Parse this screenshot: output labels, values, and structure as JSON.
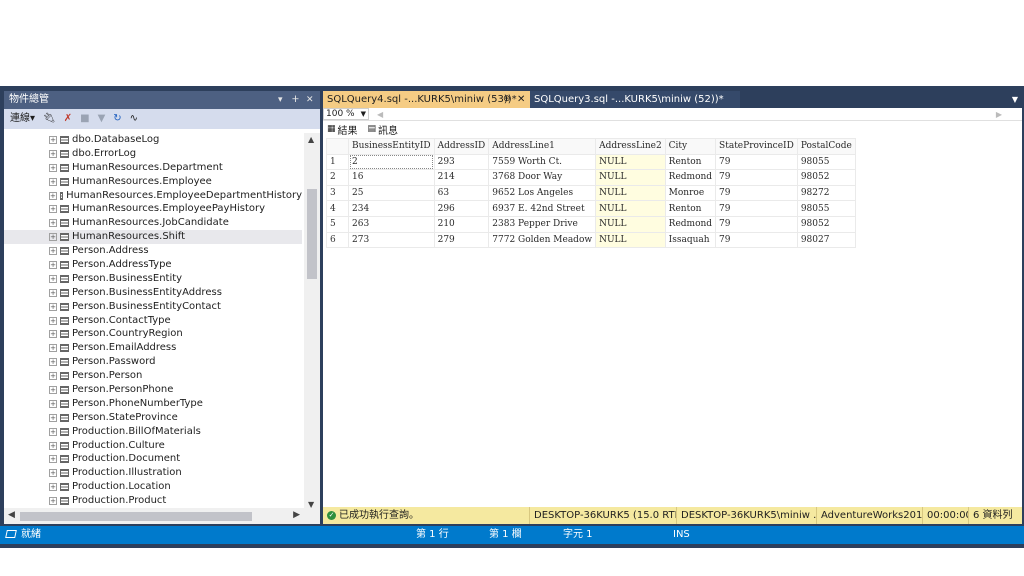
{
  "object_explorer": {
    "title": "物件總管",
    "controls": {
      "dropdown": "▾",
      "pin": "ⵜ",
      "close": "✕"
    },
    "toolbar": {
      "connect_label": "連線",
      "connect_caret": "▾"
    },
    "tree_items": [
      "dbo.DatabaseLog",
      "dbo.ErrorLog",
      "HumanResources.Department",
      "HumanResources.Employee",
      "HumanResources.EmployeeDepartmentHistory",
      "HumanResources.EmployeePayHistory",
      "HumanResources.JobCandidate",
      "HumanResources.Shift",
      "Person.Address",
      "Person.AddressType",
      "Person.BusinessEntity",
      "Person.BusinessEntityAddress",
      "Person.BusinessEntityContact",
      "Person.ContactType",
      "Person.CountryRegion",
      "Person.EmailAddress",
      "Person.Password",
      "Person.Person",
      "Person.PersonPhone",
      "Person.PhoneNumberType",
      "Person.StateProvince",
      "Production.BillOfMaterials",
      "Production.Culture",
      "Production.Document",
      "Production.Illustration",
      "Production.Location",
      "Production.Product"
    ],
    "selected_item": "HumanResources.Shift"
  },
  "tabs": [
    {
      "label": "SQLQuery4.sql -...KURK5\\miniw (53))*",
      "pin": "⊕",
      "close": "✕"
    },
    {
      "label": "SQLQuery3.sql -...KURK5\\miniw (52))*"
    }
  ],
  "zoom": "100 %",
  "result_tabs": {
    "results": "結果",
    "messages": "訊息"
  },
  "grid": {
    "columns": [
      "BusinessEntityID",
      "AddressID",
      "AddressLine1",
      "AddressLine2",
      "City",
      "StateProvinceID",
      "PostalCode"
    ],
    "rows": [
      [
        "1",
        "2",
        "293",
        "7559 Worth Ct.",
        "NULL",
        "Renton",
        "79",
        "98055"
      ],
      [
        "2",
        "16",
        "214",
        "3768 Door Way",
        "NULL",
        "Redmond",
        "79",
        "98052"
      ],
      [
        "3",
        "25",
        "63",
        "9652 Los Angeles",
        "NULL",
        "Monroe",
        "79",
        "98272"
      ],
      [
        "4",
        "234",
        "296",
        "6937 E. 42nd Street",
        "NULL",
        "Renton",
        "79",
        "98055"
      ],
      [
        "5",
        "263",
        "210",
        "2383 Pepper Drive",
        "NULL",
        "Redmond",
        "79",
        "98052"
      ],
      [
        "6",
        "273",
        "279",
        "7772 Golden Meadow",
        "NULL",
        "Issaquah",
        "79",
        "98027"
      ]
    ]
  },
  "query_status": {
    "message": "已成功執行查詢。",
    "server": "DESKTOP-36KURK5 (15.0 RTM)",
    "user": "DESKTOP-36KURK5\\miniw ...",
    "database": "AdventureWorks2019",
    "elapsed": "00:00:00",
    "rows": "6 資料列"
  },
  "app_status": {
    "ready": "就緒",
    "line": "第 1 行",
    "column": "第 1 欄",
    "char": "字元 1",
    "mode": "INS"
  }
}
